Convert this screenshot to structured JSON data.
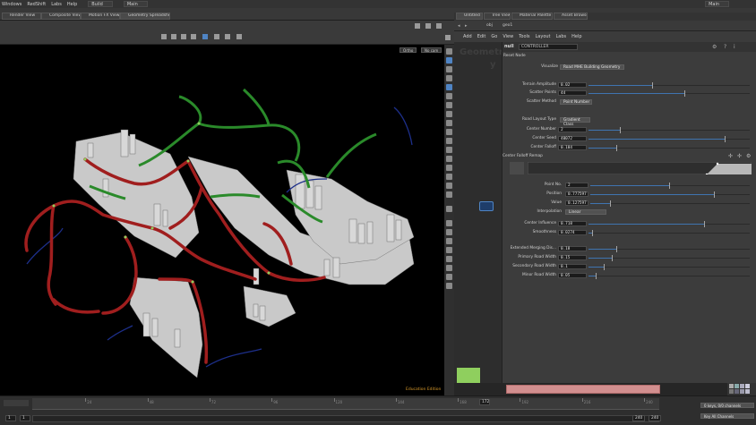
{
  "menu": {
    "items": [
      "Windows",
      "RedShift",
      "Labs",
      "Help"
    ],
    "desktop": "Build",
    "scene": "Main",
    "right_label": "Main"
  },
  "viewport_tabs": [
    "Render View",
    "Composite View",
    "Motion FX View",
    "Geometry Spreadsheet"
  ],
  "viewport": {
    "camera_menu": "Ortho",
    "display_menu": "No cam",
    "edition_label": "Education Edition"
  },
  "right_tabs": [
    "Untitled",
    "Tree View",
    "Material Palette",
    "Asset Browser"
  ],
  "path": {
    "obj": "obj",
    "node": "geo1"
  },
  "net_menu": [
    "Add",
    "Edit",
    "Go",
    "View",
    "Tools",
    "Layout",
    "Labs",
    "Help"
  ],
  "node": {
    "type": "null",
    "name": "CONTROLLER",
    "watermark_line1": "Geometr",
    "watermark_line2": "y"
  },
  "params": {
    "reset_label": "Reset Node",
    "visualize_label": "Visualize",
    "visualize_value": "Road MHE Building Geometry",
    "terrain_amplitude_label": "Terrain Amplitude",
    "terrain_amplitude": "0.02",
    "scatter_points_label": "Scatter Points",
    "scatter_points": "44",
    "scatter_method_label": "Scatter Method",
    "scatter_method": "Point Number",
    "road_layout_type_label": "Road Layout Type",
    "road_layout_type": "Gradient Class",
    "center_number_label": "Center Number",
    "center_number": "2",
    "center_seed_label": "Center Seed",
    "center_seed": "40072",
    "center_falloff_label": "Center Falloff",
    "center_falloff": "0.184",
    "ramp_label": "Center Falloff Remap",
    "point_no_label": "Point No.",
    "point_no": "2",
    "position_label": "Position",
    "position": "0.777597",
    "value_label": "Value",
    "value": "0.127597",
    "interpolation_label": "Interpolation",
    "interpolation": "Linear",
    "center_influence_label": "Center Influence",
    "center_influence": "0.718",
    "smoothness_label": "Smoothness",
    "smoothness": "0.0274",
    "extended_merging_label": "Extended Merging Dis...",
    "extended_merging": "0.18",
    "primary_road_label": "Primary Road Width",
    "primary_road": "0.15",
    "secondary_road_label": "Secondary Road Width",
    "secondary_road": "0.1",
    "minor_road_label": "Minor Road Width",
    "minor_road": "0.05"
  },
  "slider_levels": {
    "terrain_amplitude": 0.4,
    "scatter_points": 0.6,
    "center_number": 0.2,
    "center_seed": 0.85,
    "center_falloff": 0.18,
    "point_no": 0.5,
    "position": 0.78,
    "value": 0.13,
    "center_influence": 0.72,
    "smoothness": 0.03,
    "extended_merging": 0.18,
    "primary_road": 0.15,
    "secondary_road": 0.1,
    "minor_road": 0.05
  },
  "timeline": {
    "ticks": [
      "24",
      "48",
      "72",
      "96",
      "120",
      "144",
      "168",
      "192",
      "216",
      "240"
    ],
    "current_frame": "172",
    "start_field": "1",
    "start_field2": "1",
    "end_field": "240",
    "end_field2": "240",
    "channels_label": "0 keys, 0/0 channels",
    "key_channels_label": "Key All Channels"
  },
  "colors": {
    "road_primary": "#a01e1e",
    "road_secondary": "#2a8a2a",
    "road_minor": "#1d2f8a",
    "building": "#bdbdbd",
    "slider_fill": "#3f74b0",
    "accent_green": "#8fcf5e",
    "edu_label": "#d99a2b"
  }
}
